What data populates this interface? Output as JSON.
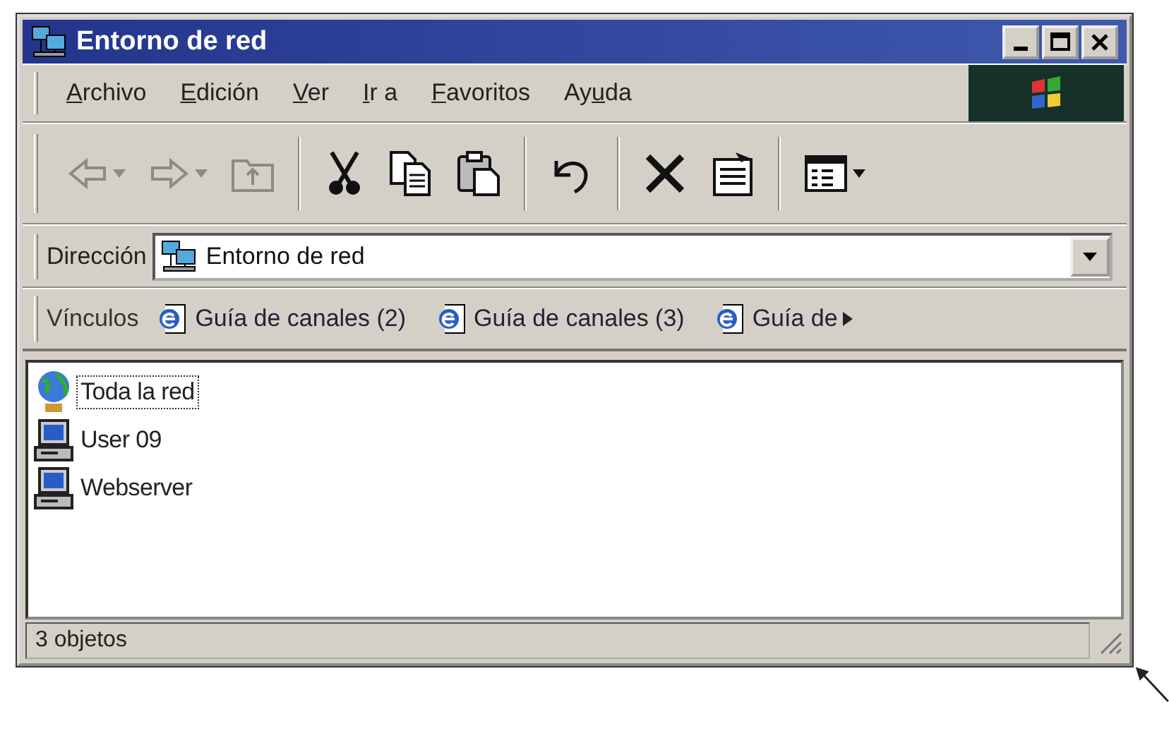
{
  "window": {
    "title": "Entorno de red",
    "controls": [
      {
        "kind": "minimize"
      },
      {
        "kind": "maximize"
      },
      {
        "kind": "close"
      }
    ]
  },
  "menu": [
    {
      "key": "A",
      "post": "rchivo"
    },
    {
      "key": "E",
      "post": "dición"
    },
    {
      "key": "V",
      "post": "er"
    },
    {
      "key": "I",
      "post": "r a"
    },
    {
      "key": "F",
      "post": "avoritos"
    },
    {
      "pre": "Ay",
      "key": "u",
      "post": "da"
    }
  ],
  "toolbar": [
    {
      "kind": "back",
      "disabled": true,
      "dropdown": true
    },
    {
      "kind": "forward",
      "disabled": true,
      "dropdown": true
    },
    {
      "kind": "up",
      "disabled": true,
      "dropdown": false
    },
    {
      "kind": "separator"
    },
    {
      "kind": "cut",
      "disabled": false,
      "dropdown": false
    },
    {
      "kind": "copy",
      "disabled": false,
      "dropdown": false
    },
    {
      "kind": "paste",
      "disabled": false,
      "dropdown": false
    },
    {
      "kind": "separator"
    },
    {
      "kind": "undo",
      "disabled": false,
      "dropdown": false
    },
    {
      "kind": "separator"
    },
    {
      "kind": "delete",
      "disabled": false,
      "dropdown": false
    },
    {
      "kind": "properties",
      "disabled": false,
      "dropdown": false
    },
    {
      "kind": "separator"
    },
    {
      "kind": "views",
      "disabled": false,
      "dropdown": true
    }
  ],
  "address": {
    "label": "Dirección",
    "value": "Entorno de red"
  },
  "links": {
    "label": "Vínculos",
    "items": [
      {
        "label": "Guía de canales (2)"
      },
      {
        "label": "Guía de canales (3)"
      },
      {
        "label": "Guía de"
      }
    ]
  },
  "items": [
    {
      "kind": "globe",
      "label": "Toda la red",
      "selected": true
    },
    {
      "kind": "computer",
      "label": "User 09",
      "selected": false
    },
    {
      "kind": "computer",
      "label": "Webserver",
      "selected": false
    }
  ],
  "status_bar": {
    "text": "3 objetos"
  }
}
